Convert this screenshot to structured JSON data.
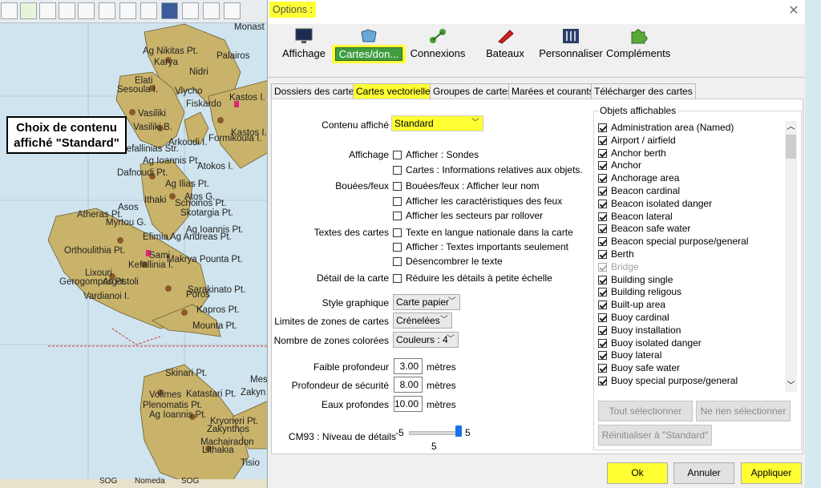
{
  "callout": {
    "line1": "Choix de contenu",
    "line2": "affiché \"Standard\""
  },
  "chart": {
    "places": [
      "Monast",
      "Ag Nikitas Pt.",
      "Palairos",
      "Karya",
      "Nidri",
      "Sesoula I.",
      "Elati",
      "Vlycho",
      "Vasiliki",
      "Kastos I.",
      "Vasiliki B.",
      "Kastos I.",
      "Fiskardo",
      "Arkoudi I.",
      "Kefallinias Str.",
      "Formikoula I.",
      "Ag Ioannis Pt.",
      "Dafnoudi Pt.",
      "Atokos I.",
      "Ag Ilias Pt.",
      "Ithaki",
      "Atos G.",
      "Schoinos Pt.",
      "Asos",
      "Atheras Pt.",
      "Skotargia Pt.",
      "Myrtou G.",
      "Ag Ioannis Pt.",
      "Efimia",
      "Ag Andreas Pt.",
      "Orthoulithia Pt.",
      "Sami",
      "Makrya Pounta Pt.",
      "Kefallinia I.",
      "Lixouri",
      "Argostoli",
      "Gerogompos Pt.",
      "Vardianoi I.",
      "Sarakinato Pt.",
      "Poros",
      "Kapros Pt.",
      "Mounta Pt.",
      "Skinari Pt.",
      "Mes",
      "Volimes",
      "Katastari Pt.",
      "Zakyn",
      "Plenomatis Pt.",
      "Ag Ioannis Pt.",
      "Kryoneri Pt.",
      "Zakynthos",
      "Machairadon",
      "Lithakia",
      "Tisio",
      "SOG",
      "Nomeda",
      "SOG"
    ]
  },
  "dialog": {
    "title": "Options :",
    "categories": [
      {
        "label": "Affichage",
        "icon": "monitor-icon"
      },
      {
        "label": "Cartes/don...",
        "icon": "charts-icon"
      },
      {
        "label": "Connexions",
        "icon": "connections-icon"
      },
      {
        "label": "Bateaux",
        "icon": "boat-icon"
      },
      {
        "label": "Personnaliser",
        "icon": "sliders-icon"
      },
      {
        "label": "Compléments",
        "icon": "puzzle-icon"
      }
    ],
    "tabs": [
      "Dossiers des cartes",
      "Cartes vectorielles",
      "Groupes de cartes",
      "Marées et courants",
      "Télécharger des cartes"
    ],
    "content": {
      "label": "Contenu affiché",
      "value": "Standard"
    },
    "affichage": {
      "label": "Affichage",
      "items": [
        "Afficher : Sondes",
        "Cartes : Informations relatives aux objets."
      ]
    },
    "bouees": {
      "label": "Bouées/feux",
      "items": [
        "Bouées/feux : Afficher leur nom",
        "Afficher les caractéristiques des feux",
        "Afficher les secteurs par rollover"
      ]
    },
    "textes": {
      "label": "Textes des cartes",
      "items": [
        "Texte en langue nationale dans la carte",
        "Afficher : Textes importants seulement",
        "Désencombrer le texte"
      ]
    },
    "detail": {
      "label": "Détail de la carte",
      "item": "Réduire les détails à petite échelle"
    },
    "style": {
      "label": "Style graphique",
      "value": "Carte papier"
    },
    "limites": {
      "label": "Limites de zones de cartes",
      "value": "Crénelées"
    },
    "zones": {
      "label": "Nombre de zones colorées",
      "value": "Couleurs : 4"
    },
    "depths": [
      {
        "label": "Faible profondeur",
        "value": "3.00",
        "unit": "mètres"
      },
      {
        "label": "Profondeur de sécurité",
        "value": "8.00",
        "unit": "mètres"
      },
      {
        "label": "Eaux profondes",
        "value": "10.00",
        "unit": "mètres"
      }
    ],
    "cm93": {
      "label": "CM93 : Niveau de détails",
      "min": "-5",
      "max": "5",
      "value": "5",
      "fraction": 1.0
    },
    "objets": {
      "title": "Objets affichables",
      "items": [
        {
          "label": "Administration area (Named)",
          "checked": true,
          "disabled": false
        },
        {
          "label": "Airport / airfield",
          "checked": true,
          "disabled": false
        },
        {
          "label": "Anchor berth",
          "checked": true,
          "disabled": false
        },
        {
          "label": "Anchor",
          "checked": true,
          "disabled": false
        },
        {
          "label": "Anchorage area",
          "checked": true,
          "disabled": false
        },
        {
          "label": "Beacon cardinal",
          "checked": true,
          "disabled": false
        },
        {
          "label": "Beacon isolated danger",
          "checked": true,
          "disabled": false
        },
        {
          "label": "Beacon lateral",
          "checked": true,
          "disabled": false
        },
        {
          "label": "Beacon safe water",
          "checked": true,
          "disabled": false
        },
        {
          "label": "Beacon special purpose/general",
          "checked": true,
          "disabled": false
        },
        {
          "label": "Berth",
          "checked": true,
          "disabled": false
        },
        {
          "label": "Bridge",
          "checked": true,
          "disabled": true
        },
        {
          "label": "Building single",
          "checked": true,
          "disabled": false
        },
        {
          "label": "Building religous",
          "checked": true,
          "disabled": false
        },
        {
          "label": "Built-up area",
          "checked": true,
          "disabled": false
        },
        {
          "label": "Buoy cardinal",
          "checked": true,
          "disabled": false
        },
        {
          "label": "Buoy installation",
          "checked": true,
          "disabled": false
        },
        {
          "label": "Buoy isolated danger",
          "checked": true,
          "disabled": false
        },
        {
          "label": "Buoy lateral",
          "checked": true,
          "disabled": false
        },
        {
          "label": "Buoy safe water",
          "checked": true,
          "disabled": false
        },
        {
          "label": "Buoy special purpose/general",
          "checked": true,
          "disabled": false
        }
      ],
      "select_all": "Tout sélectionner",
      "select_none": "Ne rien sélectionner",
      "reset": "Réinitialiser à \"Standard\""
    },
    "buttons": {
      "ok": "Ok",
      "cancel": "Annuler",
      "apply": "Appliquer"
    }
  },
  "colors": {
    "highlight": "#ffff33",
    "land": "#c9b36a",
    "sea": "#cfe4ee"
  }
}
